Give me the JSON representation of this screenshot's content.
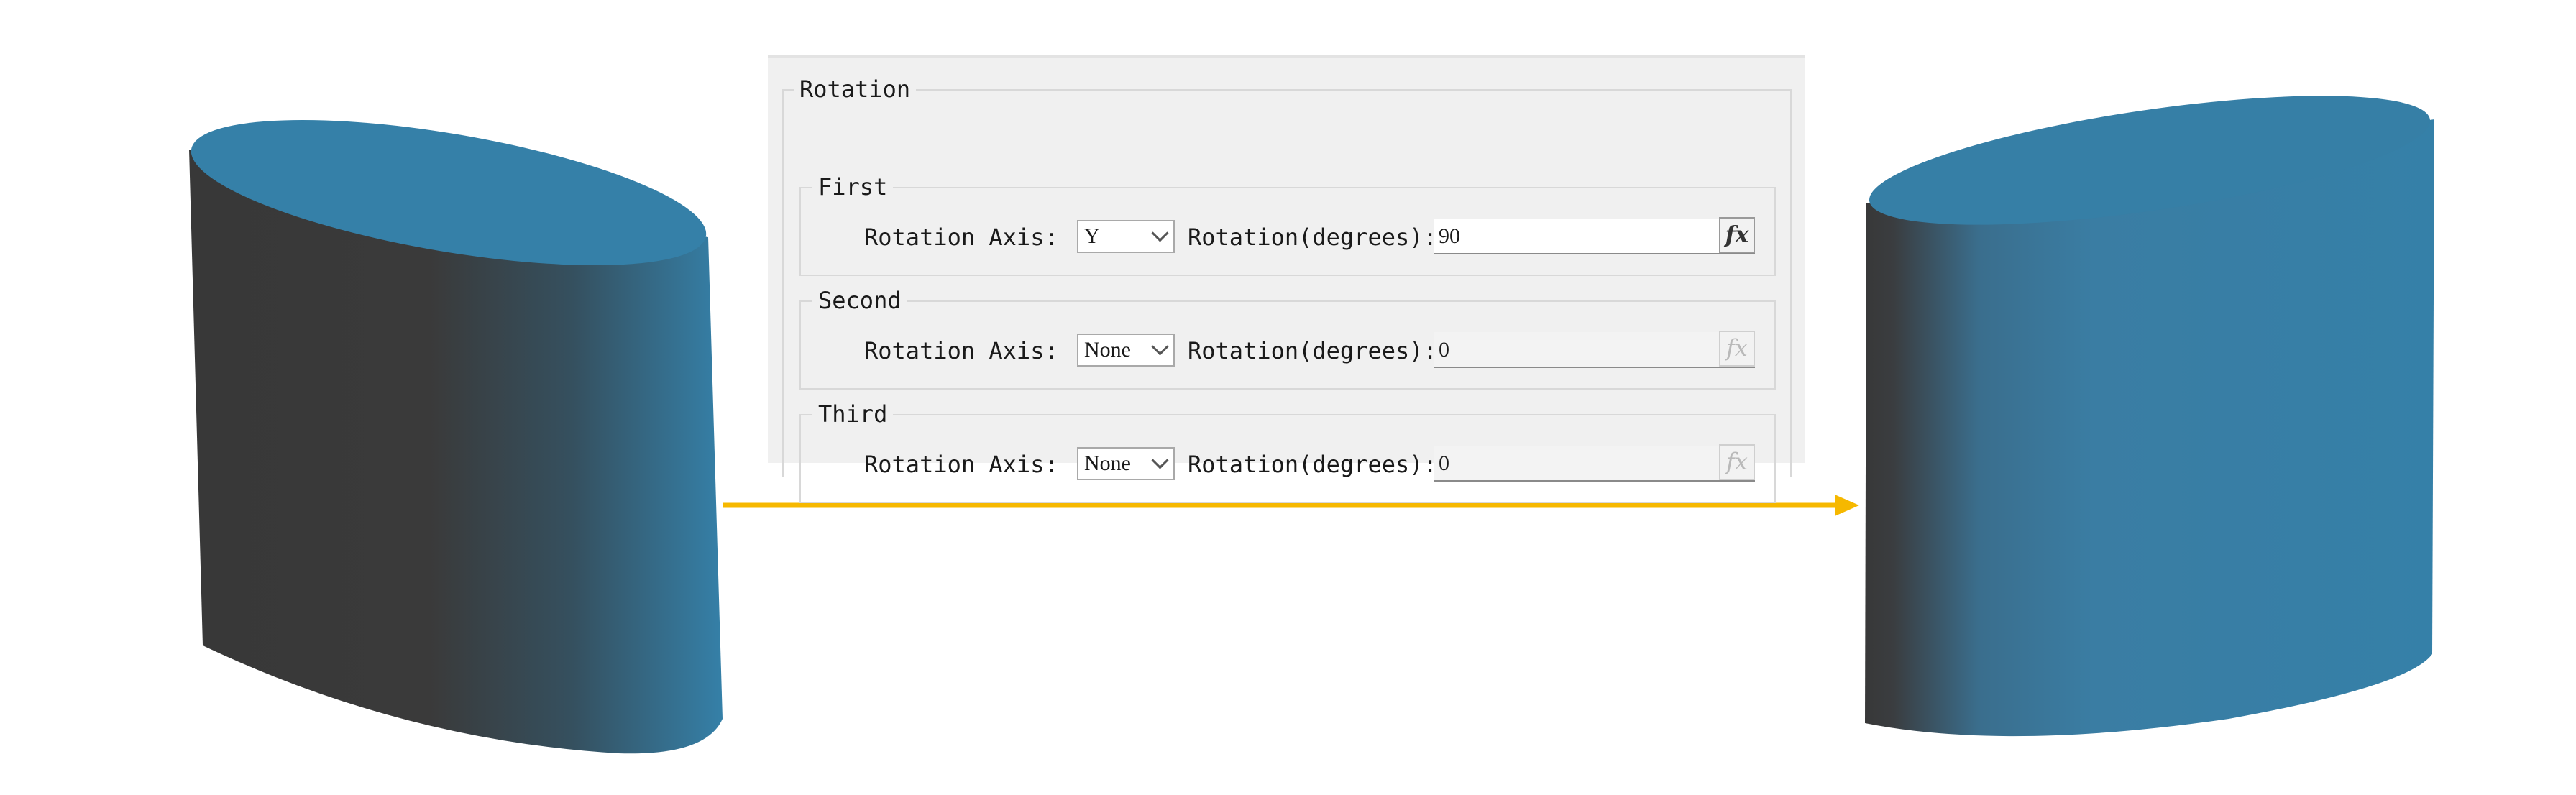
{
  "rotation": {
    "title": "Rotation",
    "groups": [
      {
        "title": "First",
        "axis_label": "Rotation Axis:",
        "axis_value": "Y",
        "degrees_label": "Rotation(degrees):",
        "degrees_value": "90",
        "fx_label": "fx",
        "enabled": true
      },
      {
        "title": "Second",
        "axis_label": "Rotation Axis:",
        "axis_value": "None",
        "degrees_label": "Rotation(degrees):",
        "degrees_value": "0",
        "fx_label": "fx",
        "enabled": false
      },
      {
        "title": "Third",
        "axis_label": "Rotation Axis:",
        "axis_value": "None",
        "degrees_label": "Rotation(degrees):",
        "degrees_value": "0",
        "fx_label": "fx",
        "enabled": false
      }
    ]
  },
  "scene": {
    "cylinder_side_dark": "#383838",
    "cylinder_color": "#3580a8",
    "arrow_color": "#f6b800"
  }
}
